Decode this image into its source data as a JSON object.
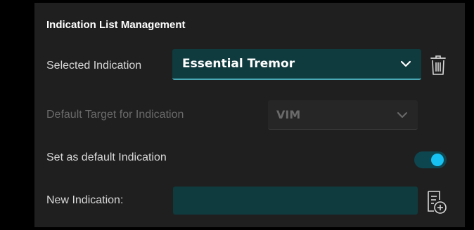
{
  "panel": {
    "title": "Indication List Management"
  },
  "selected_indication": {
    "label": "Selected Indication",
    "value": "Essential Tremor"
  },
  "default_target": {
    "label": "Default Target for Indication",
    "value": "VIM",
    "enabled": false
  },
  "set_default": {
    "label": "Set as default Indication",
    "checked": true
  },
  "new_indication": {
    "label": "New Indication:",
    "value": ""
  },
  "icons": {
    "delete": "trash-icon",
    "add": "add-list-icon",
    "dropdown": "chevron-down-icon"
  },
  "colors": {
    "panel_bg": "#1f1f1f",
    "field_bg": "#0f3a3e",
    "accent": "#17c2f2",
    "toggle_track": "#0e4650"
  }
}
